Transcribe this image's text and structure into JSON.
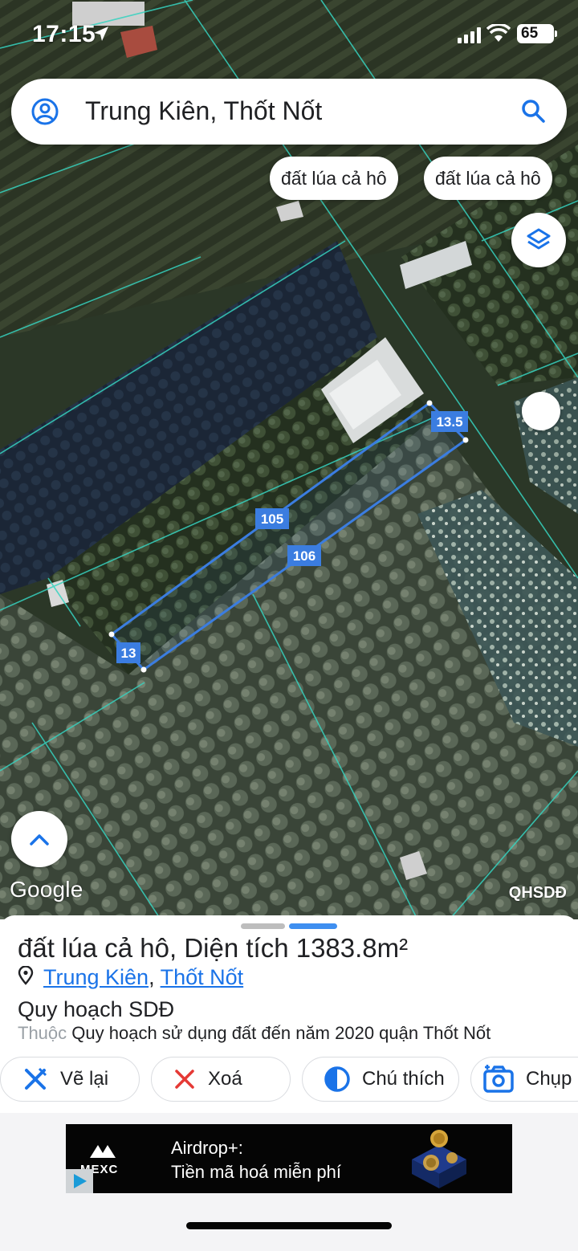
{
  "status_bar": {
    "time": "17:15",
    "battery": "65"
  },
  "search": {
    "title": "Trung Kiên, Thốt Nốt"
  },
  "chips": [
    "đất lúa cả hô",
    "đất lúa cả hô"
  ],
  "map": {
    "edge_labels": [
      "13.5",
      "105",
      "106",
      "13"
    ],
    "google_logo": "Google",
    "layer_label": "QHSDĐ"
  },
  "sheet": {
    "heading_name": "đất lúa cả hô",
    "heading_area": ", Diện tích 1383.8m²",
    "address_parts": [
      "Trung Kiên",
      "Thốt Nốt"
    ],
    "address_separator": ",",
    "plan_title": "Quy hoạch SDĐ",
    "belongs_prefix": "Thuộc",
    "belongs_text": "Quy hoạch sử dụng đất đến năm 2020 quận Thốt Nốt"
  },
  "actions": [
    {
      "label": "Vẽ lại",
      "icon": "redraw-icon"
    },
    {
      "label": "Xoá",
      "icon": "close-icon"
    },
    {
      "label": "Chú thích",
      "icon": "contrast-icon"
    },
    {
      "label": "Chụp",
      "icon": "camera-icon"
    }
  ],
  "ad": {
    "brand": "MEXC",
    "line1": "Airdrop+:",
    "line2": "Tiền mã hoá miễn phí"
  },
  "colors": {
    "accent": "#1a73e8",
    "parcel": "#3b7de0",
    "boundary": "#36d3c0"
  }
}
